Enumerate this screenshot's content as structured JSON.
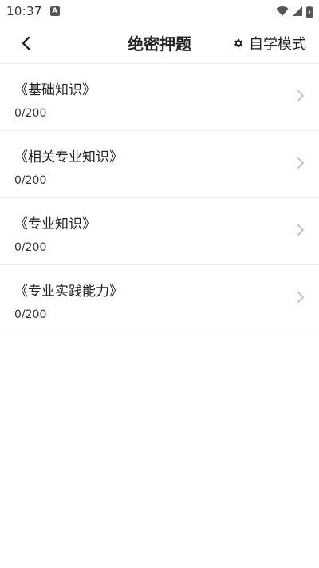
{
  "status_bar": {
    "time": "10:37",
    "app_icon": "A",
    "icons": [
      "wifi-icon",
      "cell-signal-icon",
      "battery-icon"
    ]
  },
  "app_bar": {
    "back_icon": "chevron-left-icon",
    "title": "绝密押题",
    "mode_icon": "gear-icon",
    "mode_label": "自学模式"
  },
  "items": [
    {
      "title": "《基础知识》",
      "progress": "0/200"
    },
    {
      "title": "《相关专业知识》",
      "progress": "0/200"
    },
    {
      "title": "《专业知识》",
      "progress": "0/200"
    },
    {
      "title": "《专业实践能力》",
      "progress": "0/200"
    }
  ],
  "colors": {
    "background": "#ffffff",
    "divider": "#eeeeee",
    "text": "#222222",
    "chevron": "#bbbbbb"
  }
}
